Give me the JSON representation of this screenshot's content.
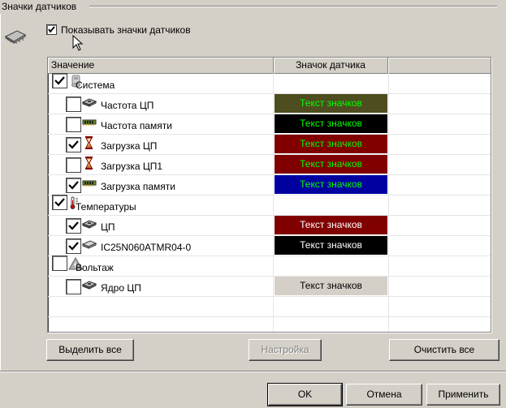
{
  "group": {
    "title": "Значки датчиков"
  },
  "show_icons": {
    "label": "Показывать значки датчиков",
    "checked": true
  },
  "list": {
    "columns": [
      "Значение",
      "Значок датчика"
    ],
    "rows": [
      {
        "label": "Система",
        "checked": true,
        "level": 0,
        "icon": "system-icon",
        "swatch": null
      },
      {
        "label": "Частота ЦП",
        "checked": false,
        "level": 1,
        "icon": "cpu-chip-icon",
        "swatch": {
          "text": "Текст значков",
          "bg": "#4d4d1f",
          "fg": "#00ff00"
        }
      },
      {
        "label": "Частота памяти",
        "checked": false,
        "level": 1,
        "icon": "memory-icon",
        "swatch": {
          "text": "Текст значков",
          "bg": "#000000",
          "fg": "#00ff00"
        }
      },
      {
        "label": "Загрузка ЦП",
        "checked": true,
        "level": 1,
        "icon": "hourglass-icon",
        "swatch": {
          "text": "Текст значков",
          "bg": "#800000",
          "fg": "#00ff00"
        }
      },
      {
        "label": "Загрузка ЦП1",
        "checked": false,
        "level": 1,
        "icon": "hourglass-icon",
        "swatch": {
          "text": "Текст значков",
          "bg": "#800000",
          "fg": "#00ff00"
        }
      },
      {
        "label": "Загрузка памяти",
        "checked": true,
        "level": 1,
        "icon": "memory-icon",
        "swatch": {
          "text": "Текст значков",
          "bg": "#0000a0",
          "fg": "#00ff00"
        }
      },
      {
        "label": "Температуры",
        "checked": true,
        "level": 0,
        "icon": "thermometer-icon",
        "swatch": null
      },
      {
        "label": "ЦП",
        "checked": true,
        "level": 1,
        "icon": "cpu-chip-icon",
        "swatch": {
          "text": "Текст значков",
          "bg": "#800000",
          "fg": "#ffffff"
        }
      },
      {
        "label": "IC25N060ATMR04-0",
        "checked": true,
        "level": 1,
        "icon": "hard-drive-icon",
        "swatch": {
          "text": "Текст значков",
          "bg": "#000000",
          "fg": "#ffffff"
        }
      },
      {
        "label": "Вольтаж",
        "checked": false,
        "level": 0,
        "icon": "voltage-icon",
        "swatch": null
      },
      {
        "label": "Ядро ЦП",
        "checked": false,
        "level": 1,
        "icon": "cpu-chip-icon",
        "swatch": {
          "text": "Текст значков",
          "bg": "#d4d0c8",
          "fg": "#000000"
        }
      }
    ]
  },
  "buttons": {
    "select_all": "Выделить все",
    "settings": "Настройка",
    "clear_all": "Очистить все",
    "ok": "OK",
    "cancel": "Отмена",
    "apply": "Применить"
  }
}
